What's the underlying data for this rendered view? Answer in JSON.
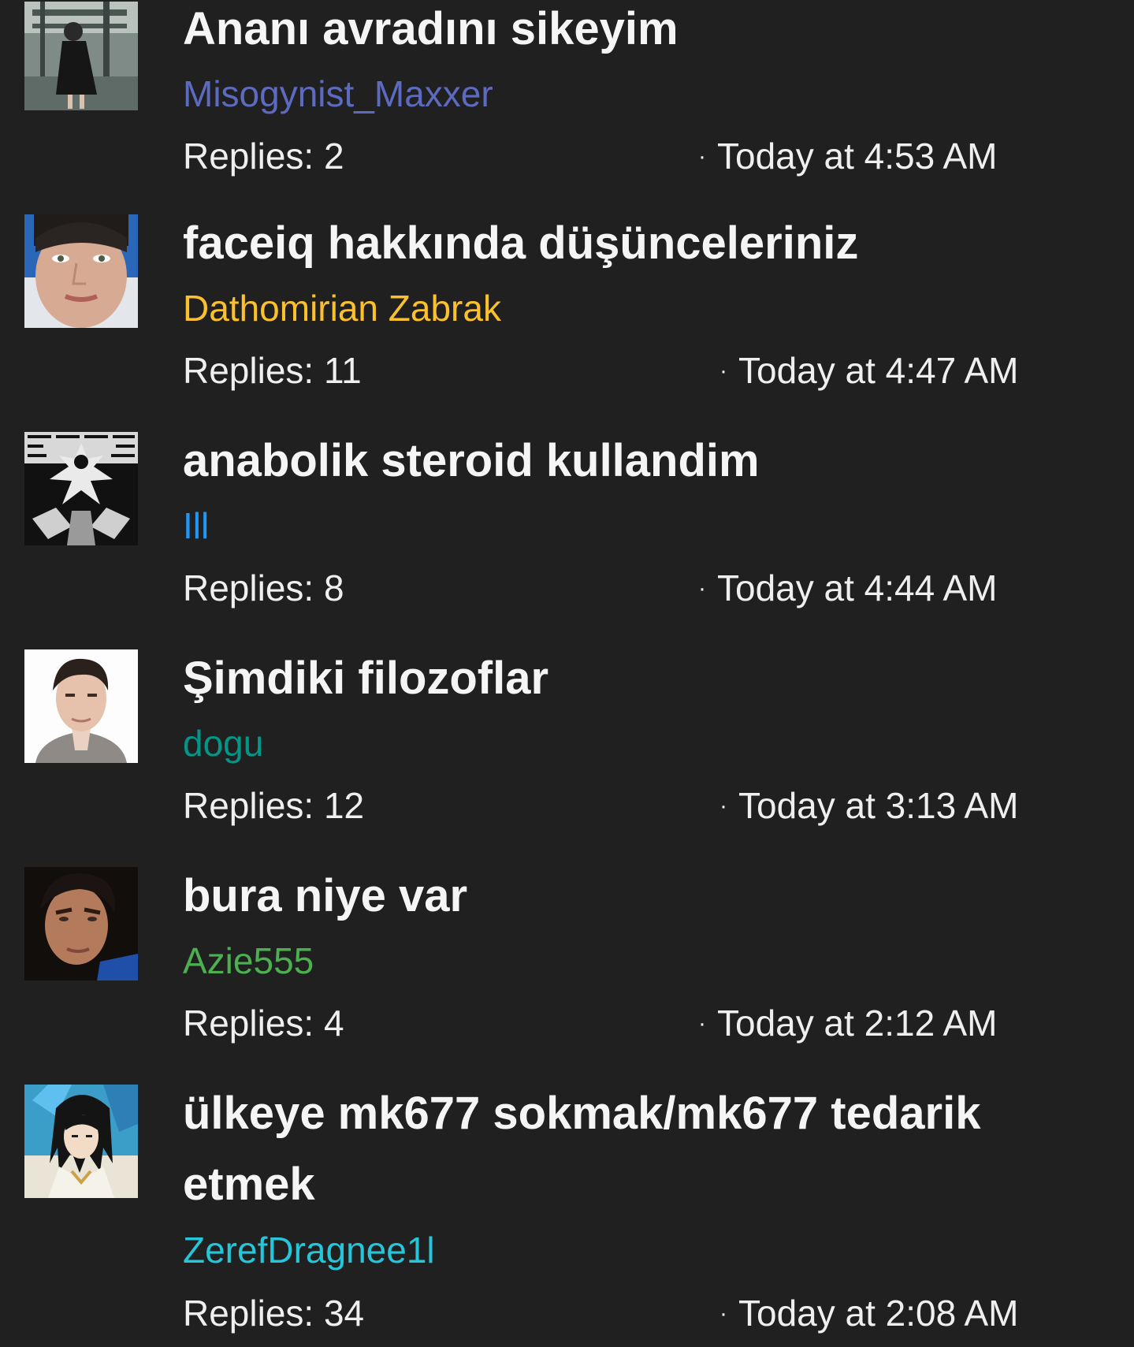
{
  "colors": {
    "background": "#202020",
    "text": "#f2f2f2"
  },
  "threads": [
    {
      "title": "Ananı avradını sikeyim",
      "author": "Misogynist_Maxxer",
      "author_color": "#5c6bc0",
      "replies": "Replies: 2",
      "time": "Today at 4:53 AM",
      "avatar_icon": "avatar-photo-person-in-black-dress"
    },
    {
      "title": "faceiq hakkında düşünceleriniz",
      "author": "Dathomirian Zabrak",
      "author_color": "#fbc02d",
      "replies": "Replies: 11",
      "time": "Today at 4:47 AM",
      "avatar_icon": "avatar-photo-face-closeup"
    },
    {
      "title": "anabolik steroid kullandim",
      "author": "Ill",
      "author_color": "#2196f3",
      "replies": "Replies: 8",
      "time": "Today at 4:44 AM",
      "avatar_icon": "avatar-black-white-artwork"
    },
    {
      "title": "Şimdiki filozoflar",
      "author": "dogu",
      "author_color": "#009688",
      "replies": "Replies: 12",
      "time": "Today at 3:13 AM",
      "avatar_icon": "avatar-photo-man-portrait"
    },
    {
      "title": "bura niye var",
      "author": "Azie555",
      "author_color": "#4caf50",
      "replies": "Replies: 4",
      "time": "Today at 2:12 AM",
      "avatar_icon": "avatar-photo-man-dark"
    },
    {
      "title": "ülkeye mk677 sokmak/mk677 tedarik etmek",
      "author": "ZerefDragnee1l",
      "author_color": "#26c6da",
      "replies": "Replies: 34",
      "time": "Today at 2:08 AM",
      "avatar_icon": "avatar-anime-character"
    }
  ]
}
